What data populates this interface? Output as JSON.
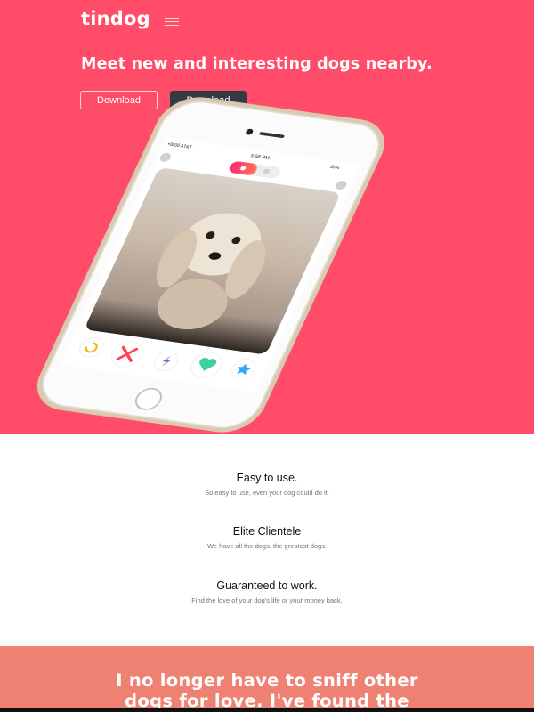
{
  "navbar": {
    "brand": "tindog",
    "menu_icon": "hamburger-icon"
  },
  "hero": {
    "headline": "Meet new and interesting dogs nearby.",
    "download_outline_label": "Download",
    "download_dark_label": "Download",
    "background_color": "#ff4c68"
  },
  "phone": {
    "carrier": "•0000 AT&T",
    "time": "5:58 PM",
    "battery": "55%",
    "action_icons": [
      "rewind-icon",
      "nope-icon",
      "boost-icon",
      "like-icon",
      "superlike-icon"
    ]
  },
  "features": [
    {
      "title": "Easy to use.",
      "description": "So easy to use, even your dog could do it."
    },
    {
      "title": "Elite Clientele",
      "description": "We have all the dogs, the greatest dogs."
    },
    {
      "title": "Guaranteed to work.",
      "description": "Find the love of your dog's life or your money back."
    }
  ],
  "testimonial": {
    "quote_line1": "I no longer have to sniff other",
    "quote_line2": "dogs for love. I've found the",
    "background_color": "#ef8172"
  }
}
